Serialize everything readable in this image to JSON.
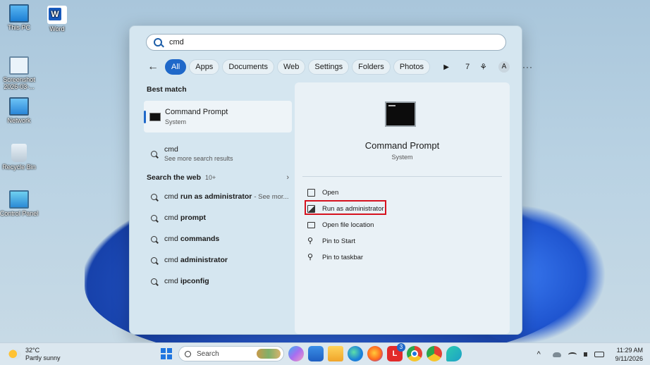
{
  "desktop": {
    "icons": [
      {
        "label": "This PC",
        "icon": "monitor-icon"
      },
      {
        "label": "Word",
        "icon": "word-icon"
      },
      {
        "label": "Screenshot 2026-03-...",
        "icon": "screenshot-file-icon"
      },
      {
        "label": "Network",
        "icon": "network-icon"
      },
      {
        "label": "Recycle Bin",
        "icon": "recycle-bin-icon"
      },
      {
        "label": "Control Panel",
        "icon": "control-panel-icon"
      }
    ]
  },
  "search": {
    "query": "cmd",
    "filters": [
      "All",
      "Apps",
      "Documents",
      "Web",
      "Settings",
      "Folders",
      "Photos"
    ],
    "active_filter": "All",
    "points_count": "7",
    "avatar_letter": "A"
  },
  "results": {
    "best_match_title": "Best match",
    "best_match": {
      "title": "Command Prompt",
      "subtitle": "System"
    },
    "more_results": {
      "title": "cmd",
      "subtitle": "See more search results"
    },
    "web_header": "Search the web",
    "web_count": "10+",
    "web_items": [
      {
        "prefix": "cmd",
        "bold": "run as administrator",
        "suffix": "- See mor..."
      },
      {
        "prefix": "cmd",
        "bold": "prompt",
        "suffix": ""
      },
      {
        "prefix": "cmd",
        "bold": "commands",
        "suffix": ""
      },
      {
        "prefix": "cmd",
        "bold": "administrator",
        "suffix": ""
      },
      {
        "prefix": "cmd",
        "bold": "ipconfig",
        "suffix": ""
      }
    ]
  },
  "details": {
    "app_name": "Command Prompt",
    "app_type": "System",
    "actions": [
      "Open",
      "Run as administrator",
      "Open file location",
      "Pin to Start",
      "Pin to taskbar"
    ],
    "highlighted_action": "Run as administrator"
  },
  "taskbar": {
    "weather_temp": "32°C",
    "weather_desc": "Partly sunny",
    "search_label": "Search",
    "badge_count": "3",
    "time": "11:29 AM",
    "date": "9/11/2026"
  },
  "colors": {
    "accent": "#1f68c9",
    "highlight_border": "#d6121f"
  }
}
